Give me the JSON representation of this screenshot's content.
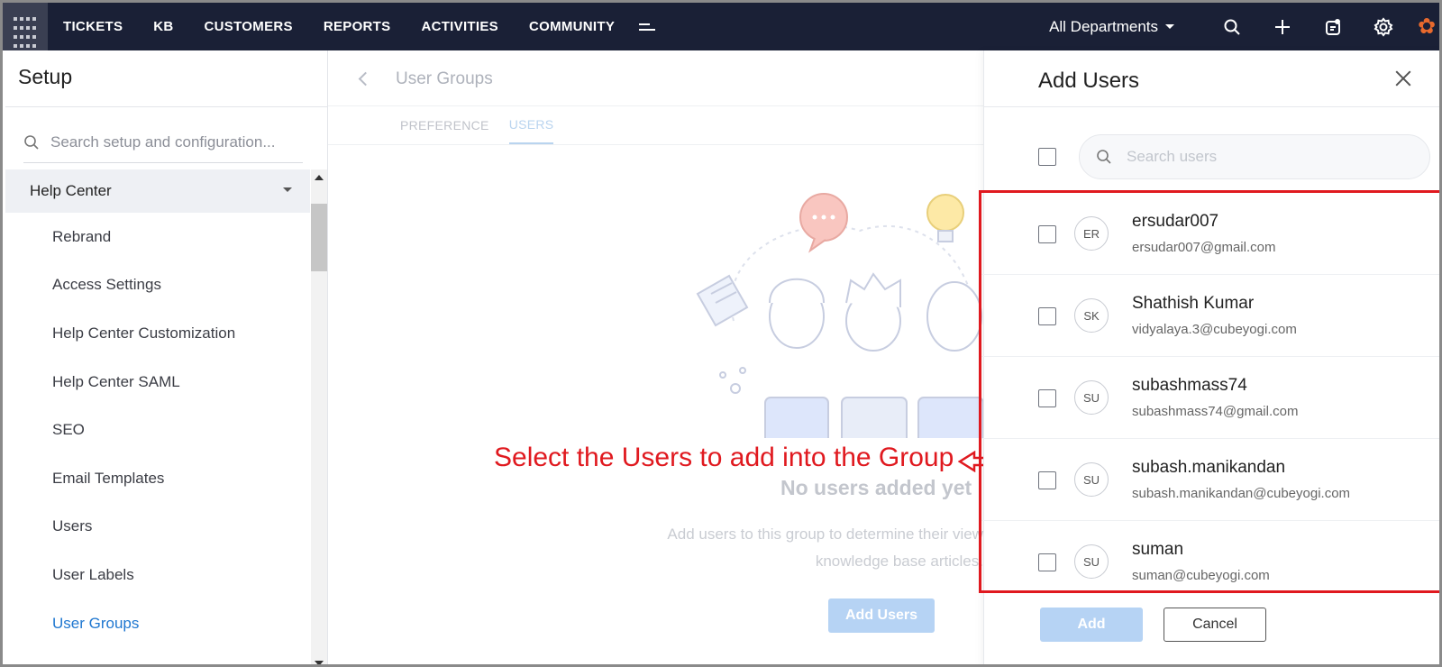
{
  "topnav": {
    "items": [
      "TICKETS",
      "KB",
      "CUSTOMERS",
      "REPORTS",
      "ACTIVITIES",
      "COMMUNITY"
    ],
    "department": "All Departments"
  },
  "setup": {
    "title": "Setup",
    "search_placeholder": "Search setup and configuration...",
    "section": "Help Center",
    "items": [
      "Rebrand",
      "Access Settings",
      "Help Center Customization",
      "Help Center SAML",
      "SEO",
      "Email Templates",
      "Users",
      "User Labels",
      "User Groups"
    ],
    "active_item": "User Groups"
  },
  "main": {
    "title": "User Groups",
    "tabs": [
      "PREFERENCE",
      "USERS"
    ],
    "active_tab": "USERS",
    "empty_title": "No users added yet",
    "empty_desc_line1": "Add users to this group to determine their view",
    "empty_desc_line2": "knowledge base articles.",
    "add_users_button": "Add Users"
  },
  "annotation": {
    "text": "Select the Users to add into the Group",
    "color": "#e0191f"
  },
  "drawer": {
    "title": "Add Users",
    "search_placeholder": "Search users",
    "users": [
      {
        "initials": "ER",
        "name": "ersudar007",
        "email": "ersudar007@gmail.com"
      },
      {
        "initials": "SK",
        "name": "Shathish Kumar",
        "email": "vidyalaya.3@cubeyogi.com"
      },
      {
        "initials": "SU",
        "name": "subashmass74",
        "email": "subashmass74@gmail.com"
      },
      {
        "initials": "SU",
        "name": "subash.manikandan",
        "email": "subash.manikandan@cubeyogi.com"
      },
      {
        "initials": "SU",
        "name": "suman",
        "email": "suman@cubeyogi.com"
      }
    ],
    "add_button": "Add",
    "cancel_button": "Cancel"
  },
  "colors": {
    "nav_bg": "#1a2036",
    "accent": "#1f77d0",
    "button_disabled": "#b6d3f4"
  }
}
